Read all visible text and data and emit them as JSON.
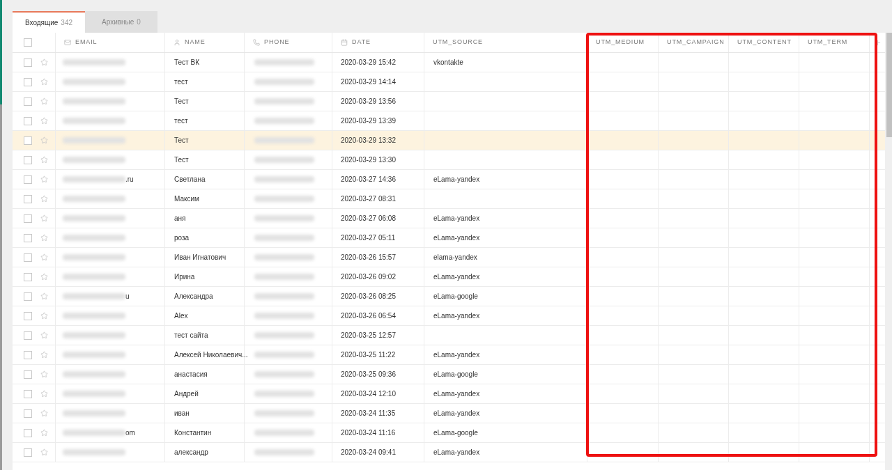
{
  "tabs": [
    {
      "label": "Входящие",
      "count": "342",
      "selected": true
    },
    {
      "label": "Архивные",
      "count": "0",
      "selected": false
    }
  ],
  "table": {
    "header_checkbox": {
      "checked": false
    },
    "columns": [
      {
        "label": "EMAIL",
        "kind": "email"
      },
      {
        "label": "NAME",
        "kind": "person"
      },
      {
        "label": "PHONE",
        "kind": "phone"
      },
      {
        "label": "DATE",
        "kind": "date"
      },
      {
        "label": "UTM_SOURCE",
        "kind": "plain"
      },
      {
        "label": "UTM_MEDIUM",
        "kind": "plain"
      },
      {
        "label": "UTM_CAMPAIGN",
        "kind": "plain"
      },
      {
        "label": "UTM_CONTENT",
        "kind": "plain"
      },
      {
        "label": "UTM_TERM",
        "kind": "plain"
      }
    ],
    "rows": [
      {
        "checked": false,
        "starred": false,
        "highlighted": false,
        "name": "Тест ВК",
        "date": "2020-03-29 15:42",
        "utm_source": "vkontakte"
      },
      {
        "checked": false,
        "starred": false,
        "highlighted": false,
        "name": "тест",
        "date": "2020-03-29 14:14"
      },
      {
        "checked": false,
        "starred": false,
        "highlighted": false,
        "name": "Тест",
        "date": "2020-03-29 13:56"
      },
      {
        "checked": false,
        "starred": false,
        "highlighted": false,
        "name": "тест",
        "date": "2020-03-29 13:39"
      },
      {
        "checked": false,
        "starred": false,
        "highlighted": true,
        "name": "Тест",
        "date": "2020-03-29 13:32"
      },
      {
        "checked": false,
        "starred": false,
        "highlighted": false,
        "name": "Тест",
        "date": "2020-03-29 13:30"
      },
      {
        "checked": false,
        "starred": false,
        "highlighted": false,
        "email_tail": ".ru",
        "name": "Светлана",
        "date": "2020-03-27 14:36",
        "utm_source": "eLama-yandex"
      },
      {
        "checked": false,
        "starred": false,
        "highlighted": false,
        "name": "Максим",
        "date": "2020-03-27 08:31"
      },
      {
        "checked": false,
        "starred": false,
        "highlighted": false,
        "name": "аня",
        "date": "2020-03-27 06:08",
        "utm_source": "eLama-yandex"
      },
      {
        "checked": false,
        "starred": false,
        "highlighted": false,
        "name": "роза",
        "date": "2020-03-27 05:11",
        "utm_source": "eLama-yandex"
      },
      {
        "checked": false,
        "starred": false,
        "highlighted": false,
        "name": "Иван Игнатович",
        "date": "2020-03-26 15:57",
        "utm_source": "elama-yandex"
      },
      {
        "checked": false,
        "starred": false,
        "highlighted": false,
        "name": "Ирина",
        "date": "2020-03-26 09:02",
        "utm_source": "eLama-yandex"
      },
      {
        "checked": false,
        "starred": false,
        "highlighted": false,
        "email_tail": "u",
        "name": "Александра",
        "date": "2020-03-26 08:25",
        "utm_source": "eLama-google"
      },
      {
        "checked": false,
        "starred": false,
        "highlighted": false,
        "name": "Alex",
        "date": "2020-03-26 06:54",
        "utm_source": "eLama-yandex"
      },
      {
        "checked": false,
        "starred": false,
        "highlighted": false,
        "name": "тест сайта",
        "date": "2020-03-25 12:57"
      },
      {
        "checked": false,
        "starred": false,
        "highlighted": false,
        "name": "Алексей Николаевич...",
        "date": "2020-03-25 11:22",
        "utm_source": "eLama-yandex"
      },
      {
        "checked": false,
        "starred": false,
        "highlighted": false,
        "name": "анастасия",
        "date": "2020-03-25 09:36",
        "utm_source": "eLama-google"
      },
      {
        "checked": false,
        "starred": false,
        "highlighted": false,
        "name": "Андрей",
        "date": "2020-03-24 12:10",
        "utm_source": "eLama-yandex"
      },
      {
        "checked": false,
        "starred": false,
        "highlighted": false,
        "name": "иван",
        "date": "2020-03-24 11:35",
        "utm_source": "eLama-yandex"
      },
      {
        "checked": false,
        "starred": false,
        "highlighted": false,
        "email_tail": "om",
        "name": "Константин",
        "date": "2020-03-24 11:16",
        "utm_source": "eLama-google"
      },
      {
        "checked": false,
        "starred": false,
        "highlighted": false,
        "name": "александр",
        "date": "2020-03-24 09:41",
        "utm_source": "eLama-yandex"
      }
    ]
  },
  "annotation": {
    "kind": "highlight-frame",
    "color": "#ee1111"
  }
}
